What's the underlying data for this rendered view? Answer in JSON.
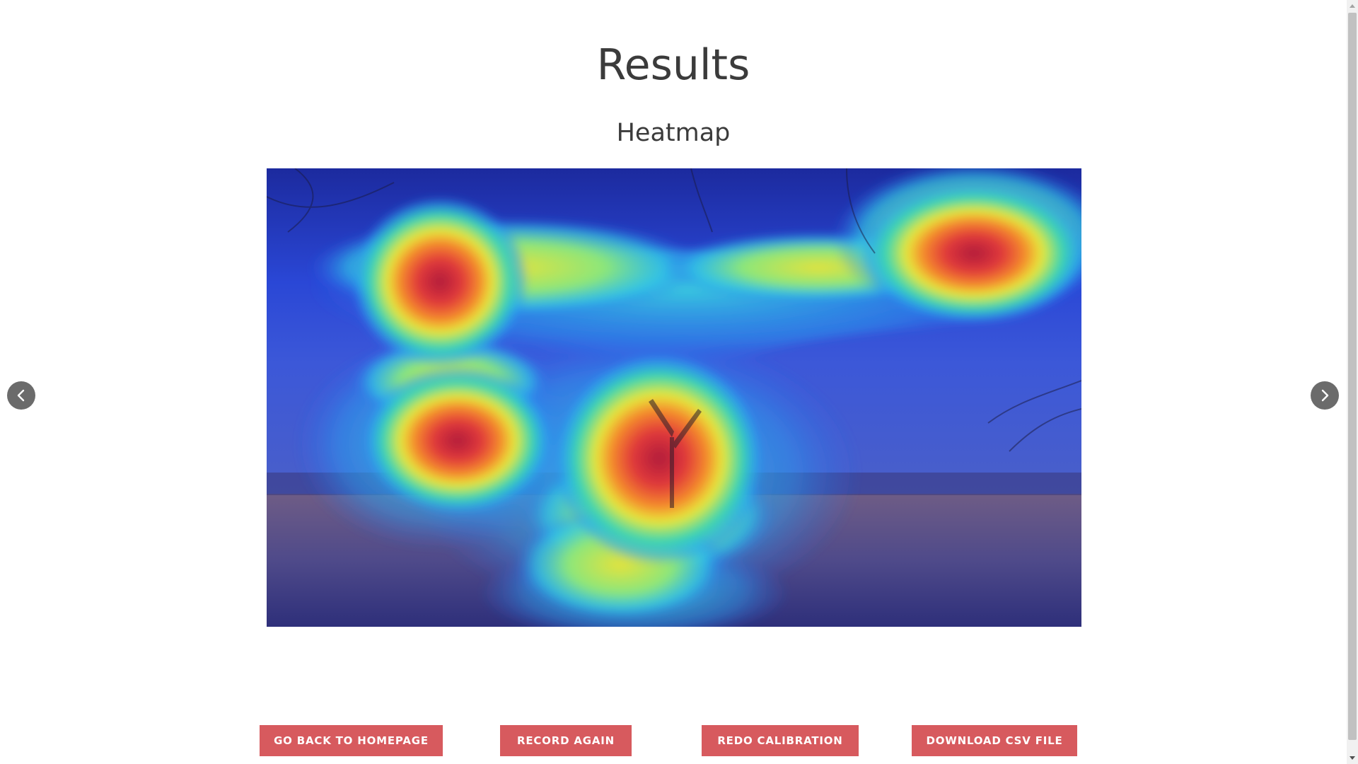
{
  "page": {
    "title": "Results",
    "subtitle": "Heatmap"
  },
  "heatmap": {
    "image_description_icon": "heatmap-overlay-image"
  },
  "carousel": {
    "prev_icon": "chevron-left-icon",
    "next_icon": "chevron-right-icon"
  },
  "actions": {
    "home_label": "GO BACK TO HOMEPAGE",
    "record_label": "RECORD AGAIN",
    "calibration_label": "REDO CALIBRATION",
    "csv_label": "DOWNLOAD CSV FILE"
  },
  "colors": {
    "button_bg": "#d75a5e",
    "title_text": "#3b3b3b",
    "nav_bg": "#6b6b6b"
  }
}
